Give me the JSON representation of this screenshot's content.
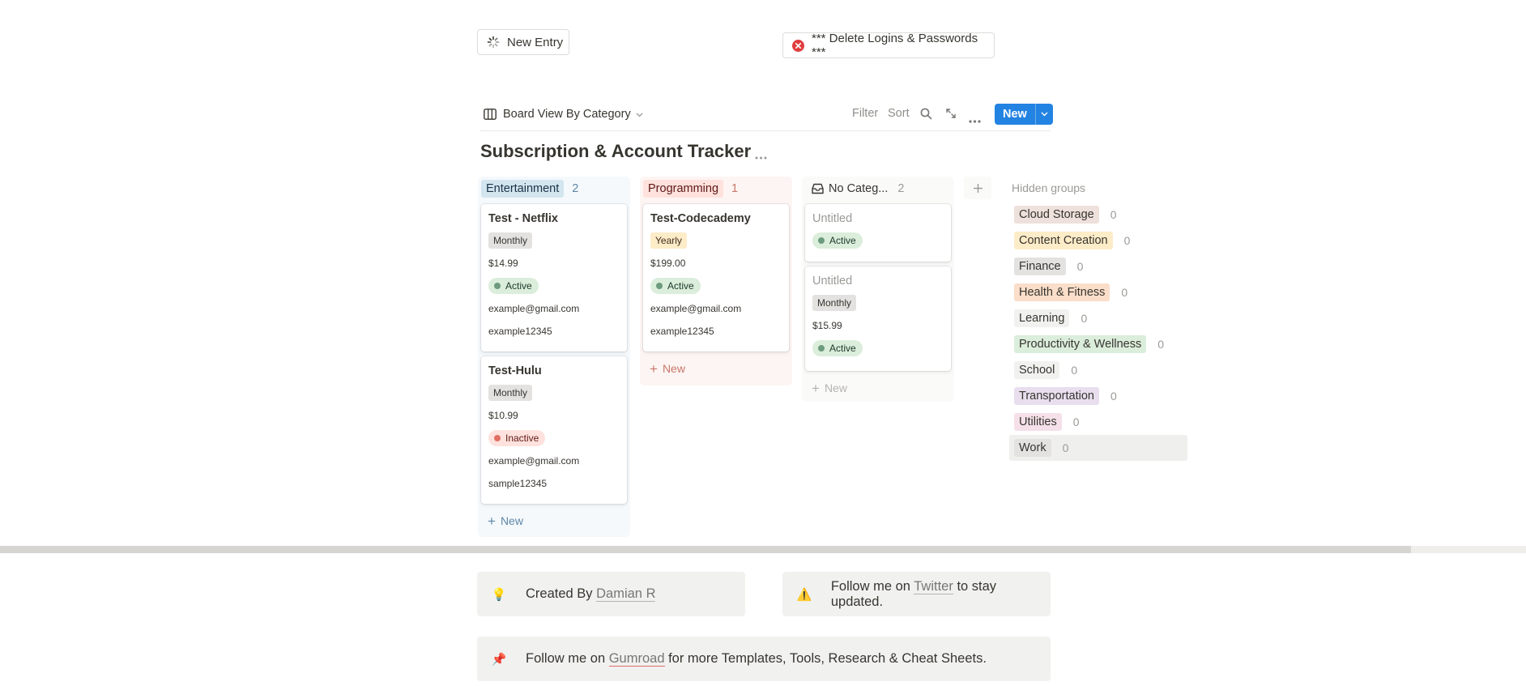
{
  "top": {
    "new_entry_label": "New Entry",
    "delete_label": "*** Delete Logins & Passwords ***"
  },
  "toolbar": {
    "view_label": "Board View By Category",
    "filter": "Filter",
    "sort": "Sort",
    "new_label": "New"
  },
  "db": {
    "title": "Subscription & Account Tracker"
  },
  "columns": [
    {
      "name": "Entertainment",
      "count": "2",
      "cards": [
        {
          "title": "Test - Netflix",
          "billing": "Monthly",
          "price": "$14.99",
          "status": "Active",
          "email": "example@gmail.com",
          "password": "example12345"
        },
        {
          "title": "Test-Hulu",
          "billing": "Monthly",
          "price": "$10.99",
          "status": "Inactive",
          "email": "example@gmail.com",
          "password": "sample12345"
        }
      ],
      "new_label": "New"
    },
    {
      "name": "Programming",
      "count": "1",
      "cards": [
        {
          "title": "Test-Codecademy",
          "billing": "Yearly",
          "price": "$199.00",
          "status": "Active",
          "email": "example@gmail.com",
          "password": "example12345"
        }
      ],
      "new_label": "New"
    },
    {
      "name": "No Categ...",
      "count": "2",
      "cards": [
        {
          "title": "Untitled",
          "status": "Active"
        },
        {
          "title": "Untitled",
          "billing": "Monthly",
          "price": "$15.99",
          "status": "Active"
        }
      ],
      "new_label": "New"
    }
  ],
  "hidden_groups": {
    "label": "Hidden groups",
    "items": [
      {
        "name": "Cloud Storage",
        "count": "0"
      },
      {
        "name": "Content Creation",
        "count": "0"
      },
      {
        "name": "Finance",
        "count": "0"
      },
      {
        "name": "Health & Fitness",
        "count": "0"
      },
      {
        "name": "Learning",
        "count": "0"
      },
      {
        "name": "Productivity & Wellness",
        "count": "0"
      },
      {
        "name": "School",
        "count": "0"
      },
      {
        "name": "Transportation",
        "count": "0"
      },
      {
        "name": "Utilities",
        "count": "0"
      },
      {
        "name": "Work",
        "count": "0"
      }
    ]
  },
  "callouts": {
    "created_prefix": "Created By ",
    "created_link": "Damian R",
    "twitter_prefix": "Follow me on ",
    "twitter_link": "Twitter",
    "twitter_suffix": " to stay updated.",
    "gumroad_prefix": "Follow me on ",
    "gumroad_link": "Gumroad",
    "gumroad_suffix": " for more Templates, Tools, Research & Cheat Sheets."
  },
  "colors": {
    "accent": "#2383e2",
    "entertainment_bg": "#d3e5ef",
    "programming_bg": "#ffe2dd",
    "active_bg": "#dbeddb",
    "active_dot": "#6c9b7d",
    "inactive_bg": "#ffe2dd",
    "inactive_dot": "#e16f64"
  }
}
